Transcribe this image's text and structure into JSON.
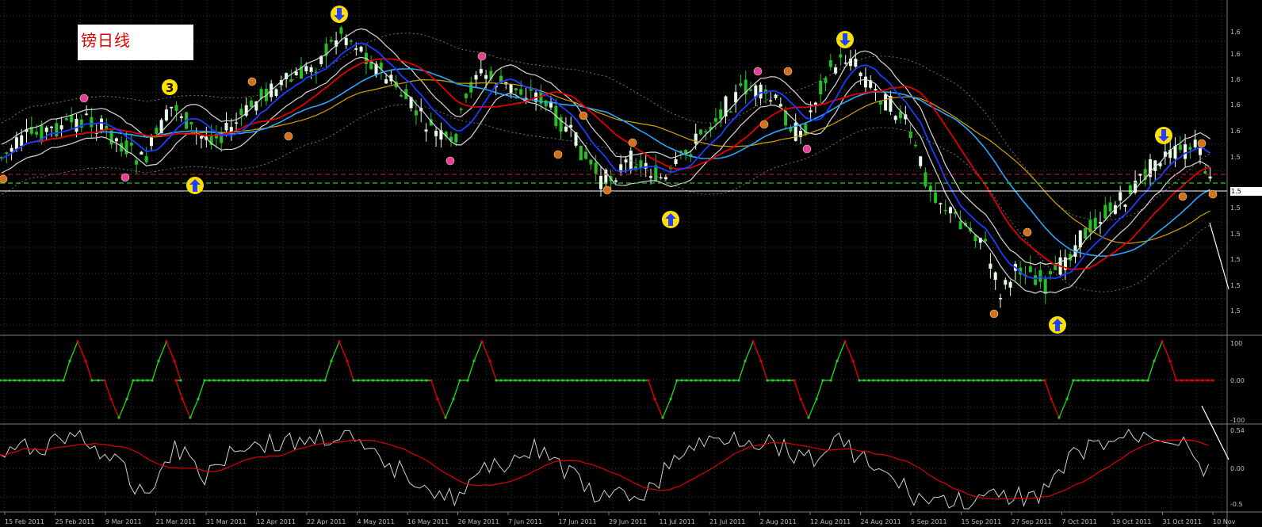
{
  "title": "镑日线",
  "price_label": "1.5",
  "colors": {
    "background": "#000000",
    "grid": "#3a3a3a",
    "bull_candle": "#e8ffe8",
    "bear_candle": "#26c026",
    "ma_red": "#e00000",
    "ma_blue": "#1a3cff",
    "ma_cyan": "#2aa6ff",
    "ma_orange": "#d8a000",
    "envelope": "#d8d8d8",
    "support_green": "#22cc22",
    "resistance_red": "#cc2222",
    "osc_up": "#22cc22",
    "osc_down": "#e00000",
    "line_white": "#d0d0d0",
    "signal_red": "#e00000",
    "arrow_yellow": "#ffe000",
    "arrow_blue": "#2040ff"
  },
  "chart_data": [
    {
      "type": "candlestick",
      "panel": "price",
      "title": "镑日线",
      "x_labels": [
        "15 Feb 2011",
        "25 Feb 2011",
        "9 Mar 2011",
        "21 Mar 2011",
        "31 Mar 2011",
        "12 Apr 2011",
        "22 Apr 2011",
        "4 May 2011",
        "16 May 2011",
        "26 May 2011",
        "7 Jun 2011",
        "17 Jun 2011",
        "29 Jun 2011",
        "11 Jul 2011",
        "21 Jul 2011",
        "2 Aug 2011",
        "12 Aug 2011",
        "24 Aug 2011",
        "5 Sep 2011",
        "15 Sep 2011",
        "27 Sep 2011",
        "7 Oct 2011",
        "19 Oct 2011",
        "31 Oct 2011",
        "10 Nov"
      ],
      "price_axis_labels": [
        "1.6",
        "1.6",
        "1.6",
        "1.6",
        "1.6",
        "1.5",
        "1.5",
        "1.5",
        "1.5",
        "1.5",
        "1.5"
      ],
      "close_path": [
        [
          0,
          0.46
        ],
        [
          0.02,
          0.52
        ],
        [
          0.04,
          0.55
        ],
        [
          0.06,
          0.58
        ],
        [
          0.08,
          0.6
        ],
        [
          0.1,
          0.63
        ],
        [
          0.12,
          0.57
        ],
        [
          0.14,
          0.45
        ],
        [
          0.16,
          0.64
        ],
        [
          0.18,
          0.72
        ],
        [
          0.2,
          0.78
        ],
        [
          0.22,
          0.85
        ],
        [
          0.25,
          0.94
        ],
        [
          0.27,
          0.98
        ],
        [
          0.29,
          0.82
        ],
        [
          0.31,
          0.76
        ],
        [
          0.33,
          0.7
        ],
        [
          0.35,
          0.72
        ],
        [
          0.37,
          0.74
        ],
        [
          0.39,
          0.76
        ],
        [
          0.41,
          0.7
        ],
        [
          0.43,
          0.66
        ],
        [
          0.45,
          0.62
        ],
        [
          0.47,
          0.55
        ],
        [
          0.49,
          0.48
        ],
        [
          0.51,
          0.4
        ],
        [
          0.53,
          0.36
        ],
        [
          0.55,
          0.32
        ],
        [
          0.57,
          0.42
        ],
        [
          0.59,
          0.7
        ],
        [
          0.61,
          0.74
        ],
        [
          0.63,
          0.78
        ],
        [
          0.65,
          0.7
        ],
        [
          0.67,
          0.82
        ],
        [
          0.69,
          0.88
        ],
        [
          0.71,
          0.82
        ],
        [
          0.73,
          0.62
        ],
        [
          0.75,
          0.45
        ],
        [
          0.77,
          0.3
        ],
        [
          0.79,
          0.15
        ],
        [
          0.81,
          0.08
        ],
        [
          0.83,
          0.03
        ],
        [
          0.85,
          0.1
        ],
        [
          0.87,
          0.2
        ],
        [
          0.89,
          0.4
        ],
        [
          0.91,
          0.52
        ],
        [
          0.93,
          0.6
        ],
        [
          0.95,
          0.75
        ],
        [
          0.97,
          0.68
        ],
        [
          0.98,
          0.55
        ]
      ],
      "buy_arrows_at": [
        "21 Mar 2011",
        "11 Jul 2011",
        "27 Sep 2011"
      ],
      "sell_arrows_at": [
        "22 Apr 2011",
        "12 Aug 2011",
        "31 Oct 2011"
      ],
      "marker_label": "3",
      "legend": []
    },
    {
      "type": "line",
      "panel": "oscillator-1",
      "y_labels": [
        "100",
        "0.00",
        "-100"
      ],
      "series": [
        {
          "values_pattern": "pulse between 100 and -100, resting at 0.00"
        }
      ]
    },
    {
      "type": "line",
      "panel": "oscillator-2",
      "y_labels": [
        "0.54",
        "0.00",
        "-0.5"
      ],
      "series": [
        {
          "values_pattern": "white oscillating line with red smoothed signal"
        }
      ]
    }
  ]
}
